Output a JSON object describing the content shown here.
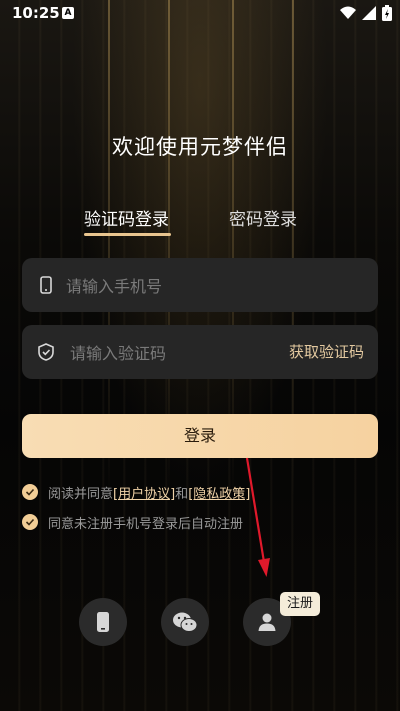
{
  "status_bar": {
    "time": "10:25",
    "badge": "A"
  },
  "title": "欢迎使用元梦伴侣",
  "tabs": [
    {
      "label": "验证码登录",
      "active": true
    },
    {
      "label": "密码登录",
      "active": false
    }
  ],
  "phone_field": {
    "placeholder": "请输入手机号",
    "value": ""
  },
  "code_field": {
    "placeholder": "请输入验证码",
    "value": "",
    "action_label": "获取验证码"
  },
  "login_button": {
    "label": "登录"
  },
  "agreement": {
    "prefix": "阅读并同意",
    "user_agreement": "[用户协议]",
    "and": "和",
    "privacy_policy": "[隐私政策]"
  },
  "auto_register": "同意未注册手机号登录后自动注册",
  "social_buttons": [
    {
      "icon": "phone-icon"
    },
    {
      "icon": "wechat-icon"
    },
    {
      "icon": "user-icon"
    }
  ],
  "tooltip": {
    "label": "注册"
  },
  "colors": {
    "accent": "#f1cd96",
    "button_gradient_start": "#f8ddb4",
    "field_bg": "#262626",
    "arrow": "#e0192b"
  }
}
